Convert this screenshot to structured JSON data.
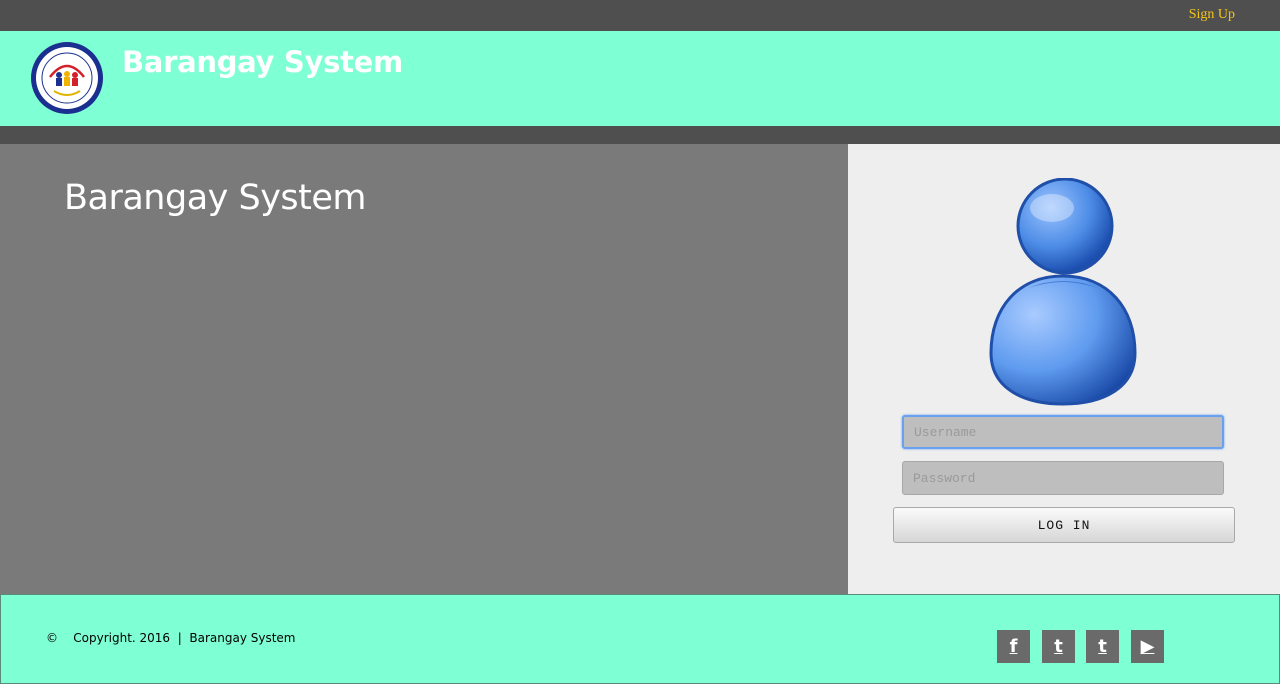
{
  "topbar": {
    "signup_label": "Sign Up"
  },
  "header": {
    "brand": "Barangay System",
    "logo_icon": "barangay-seal-icon"
  },
  "left": {
    "title": "Barangay System"
  },
  "login": {
    "avatar_icon": "user-avatar-icon",
    "username_placeholder": "Username",
    "password_placeholder": "Password",
    "button_label": "LOG IN"
  },
  "footer": {
    "copyright_symbol": "©",
    "copyright_text": "Copyright. 2016  |  Barangay System",
    "social": [
      {
        "name": "facebook-icon",
        "glyph": "f"
      },
      {
        "name": "twitter-icon",
        "glyph": "t"
      },
      {
        "name": "tumblr-icon",
        "glyph": "t"
      },
      {
        "name": "youtube-icon",
        "glyph": "▶"
      }
    ]
  },
  "colors": {
    "accent": "#7fffd4",
    "dark": "#4f4f4f",
    "link": "#f5c518",
    "panel": "#7a7a7a"
  }
}
